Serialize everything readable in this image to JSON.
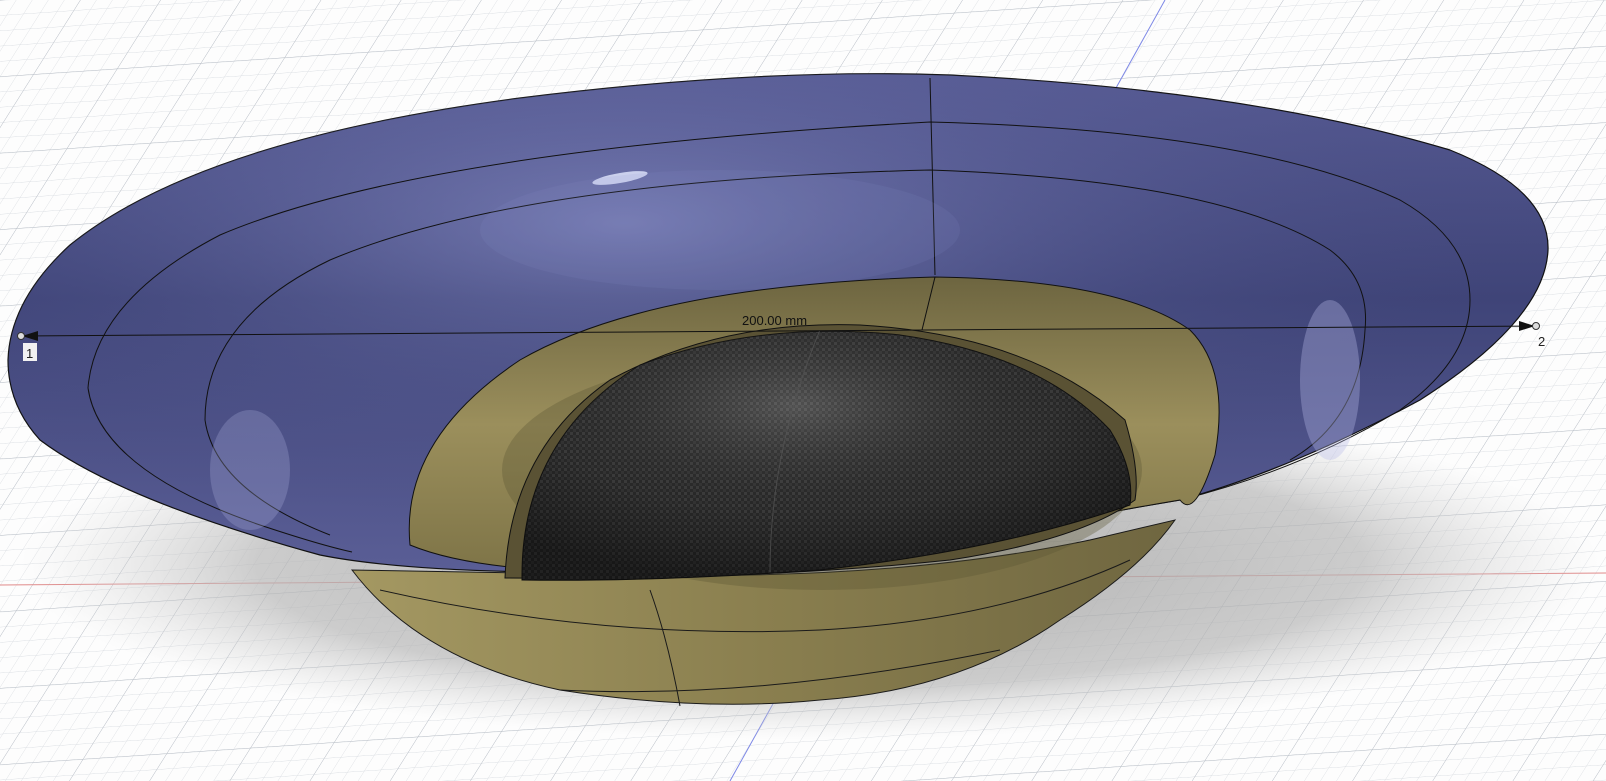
{
  "viewport": {
    "dimension_label": "200.00 mm",
    "point_labels": [
      "1",
      "2"
    ]
  },
  "colors": {
    "grid_background": "#fdfdfd",
    "grid_line": "#cfd3d8",
    "axis_x": "#e07a7a",
    "axis_z": "#7b86e0",
    "horn_flare": "#4b4f86",
    "cone_gold": "#8c8150",
    "dome_dark": "#2b2b2b",
    "shadow": "#b9b9b9"
  }
}
